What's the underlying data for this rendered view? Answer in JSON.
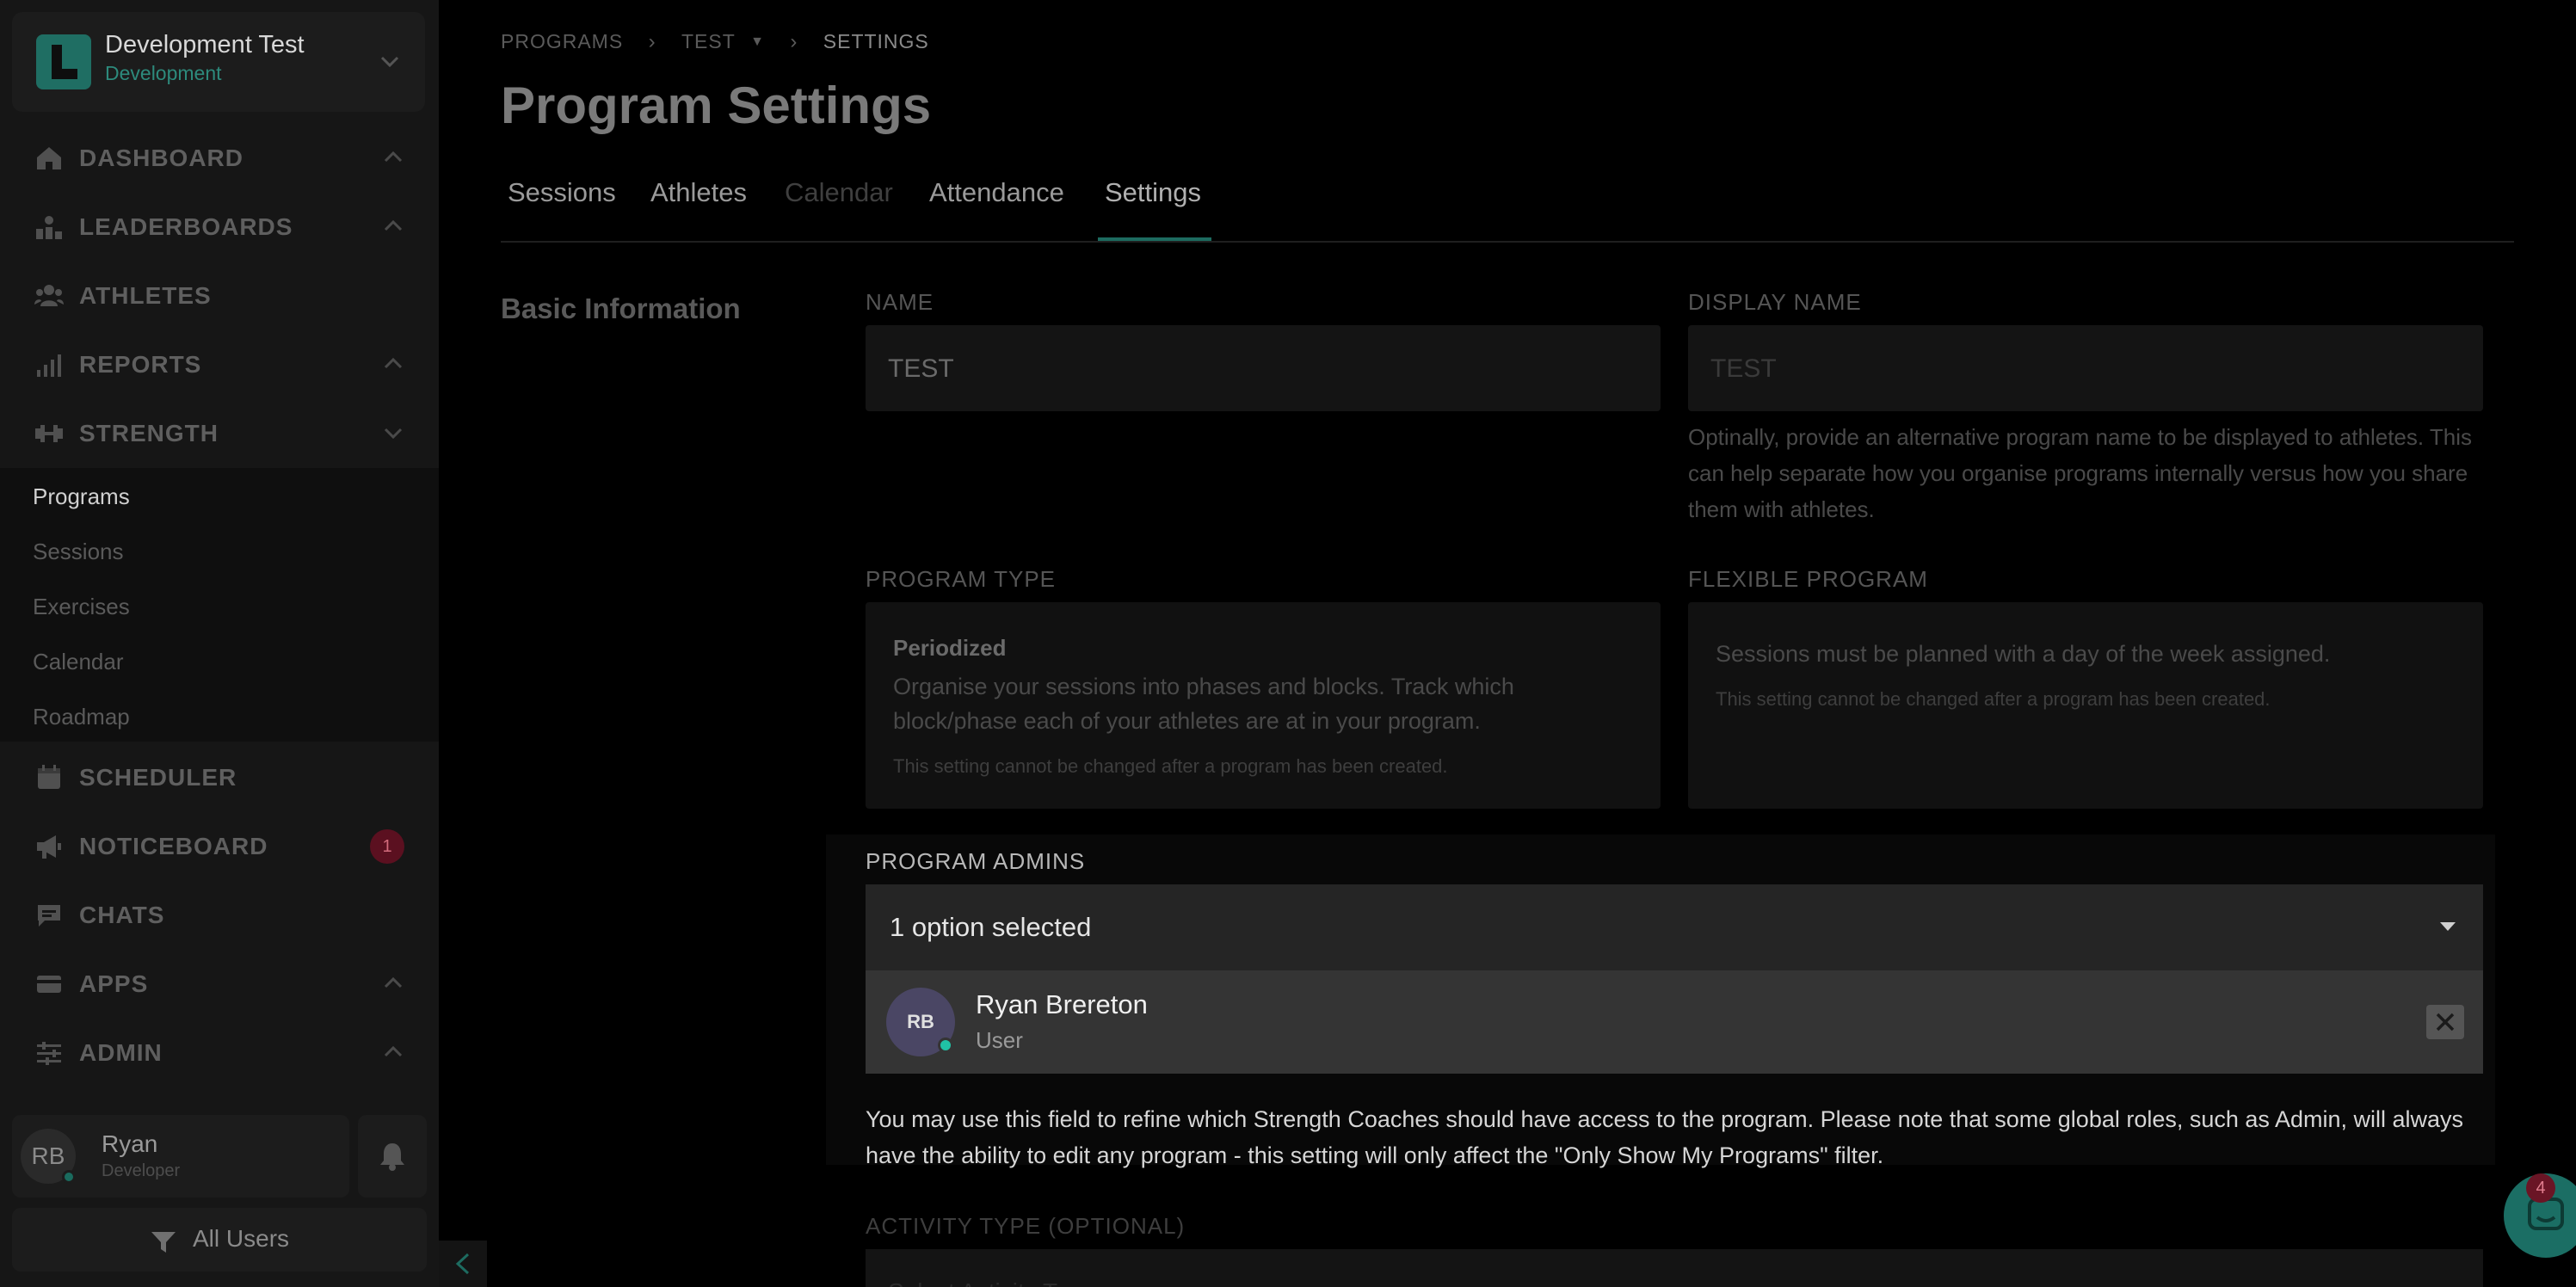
{
  "org": {
    "name": "Development Test",
    "env": "Development"
  },
  "nav": {
    "dashboard": "DASHBOARD",
    "leaderboards": "LEADERBOARDS",
    "athletes": "ATHLETES",
    "reports": "REPORTS",
    "strength": "STRENGTH",
    "scheduler": "SCHEDULER",
    "noticeboard": "NOTICEBOARD",
    "noticeboard_badge": "1",
    "chats": "CHATS",
    "apps": "APPS",
    "admin": "ADMIN"
  },
  "strength_sub": [
    "Programs",
    "Sessions",
    "Exercises",
    "Calendar",
    "Roadmap"
  ],
  "user": {
    "initials": "RB",
    "name": "Ryan",
    "role": "Developer"
  },
  "filter": {
    "label": "All Users"
  },
  "breadcrumb": {
    "programs": "PROGRAMS",
    "test": "TEST",
    "settings": "SETTINGS"
  },
  "page_title": "Program Settings",
  "tabs": [
    "Sessions",
    "Athletes",
    "Calendar",
    "Attendance",
    "Settings"
  ],
  "active_tab": "Settings",
  "section_title": "Basic Information",
  "fields": {
    "name_label": "NAME",
    "name_value": "TEST",
    "display_name_label": "DISPLAY NAME",
    "display_name_placeholder": "TEST",
    "display_name_help": "Optinally, provide an alternative program name to be displayed to athletes. This can help separate how you organise programs internally versus how you share them with athletes.",
    "program_type_label": "PROGRAM TYPE",
    "program_type_title": "Periodized",
    "program_type_desc": "Organise your sessions into phases and blocks. Track which block/phase each of your athletes are at in your program.",
    "program_type_note": "This setting cannot be changed after a program has been created.",
    "flexible_label": "FLEXIBLE PROGRAM",
    "flexible_desc": "Sessions must be planned with a day of the week assigned.",
    "flexible_note": "This setting cannot be changed after a program has been created.",
    "admins_label": "PROGRAM ADMINS",
    "admins_select_value": "1 option selected",
    "admin": {
      "initials": "RB",
      "name": "Ryan Brereton",
      "role": "User"
    },
    "admins_help": "You may use this field to refine which Strength Coaches should have access to the program. Please note that some global roles, such as Admin, will always have the ability to edit any program - this setting will only affect the \"Only Show My Programs\" filter.",
    "activity_label": "ACTIVITY TYPE (OPTIONAL)",
    "activity_placeholder": "Select Activity Type"
  },
  "chat_widget": {
    "badge": "4"
  },
  "colors": {
    "accent": "#1d6b60",
    "badge": "#5b1020"
  }
}
